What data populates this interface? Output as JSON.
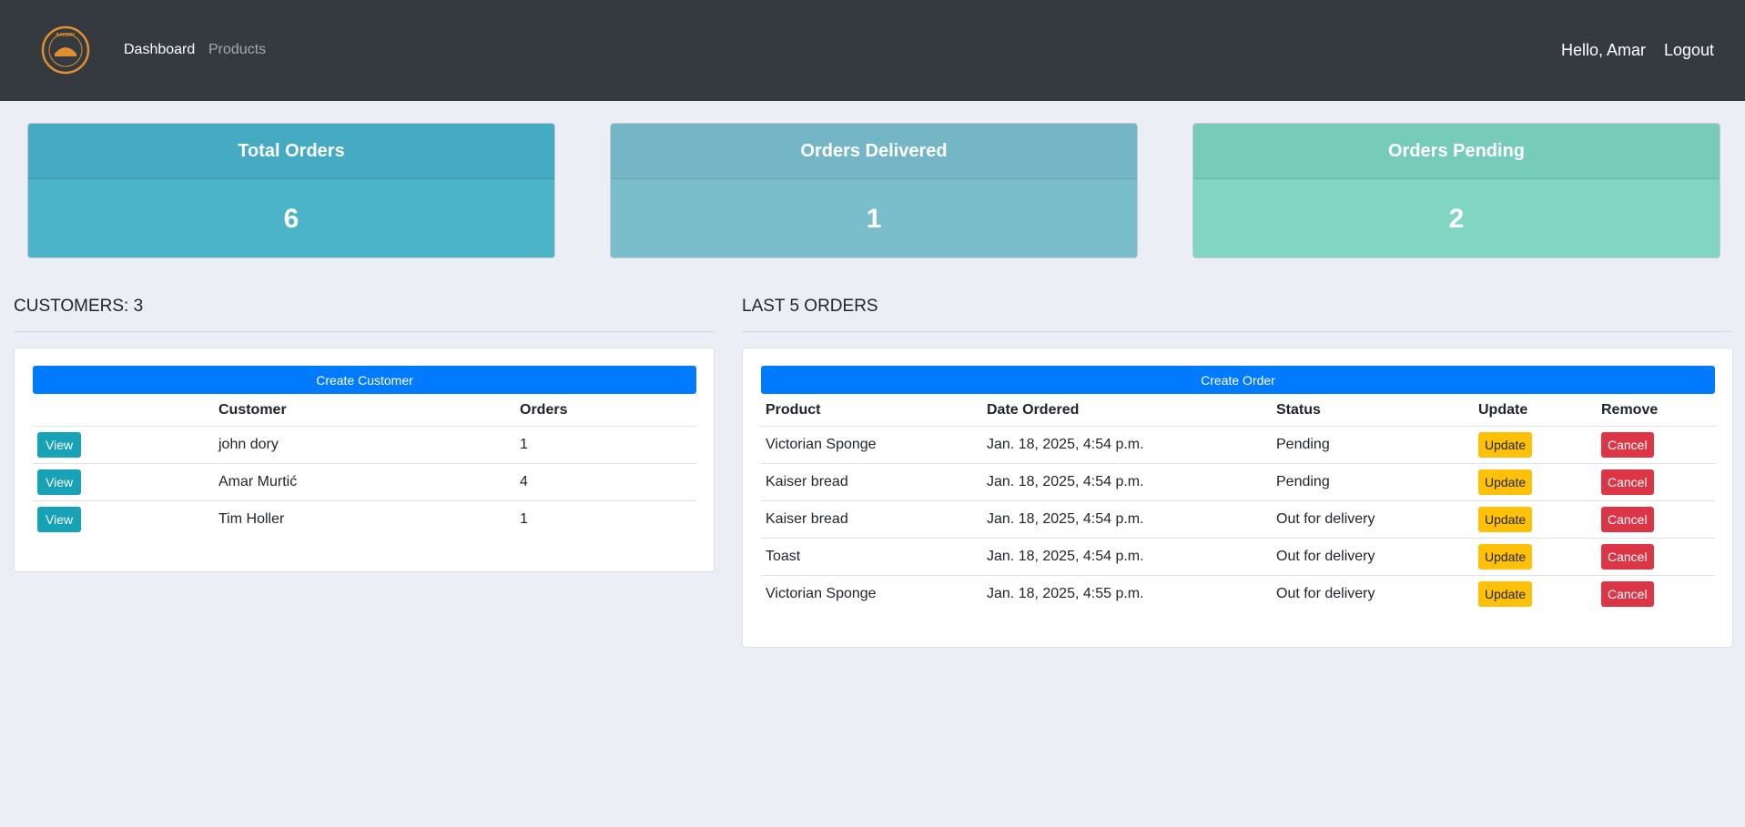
{
  "navbar": {
    "links": [
      {
        "label": "Dashboard"
      },
      {
        "label": "Products"
      }
    ],
    "greeting": "Hello, Amar",
    "logout": "Logout",
    "logo_text": "BAKERY"
  },
  "stats": [
    {
      "title": "Total Orders",
      "value": "6"
    },
    {
      "title": "Orders Delivered",
      "value": "1"
    },
    {
      "title": "Orders Pending",
      "value": "2"
    }
  ],
  "customers": {
    "heading": "CUSTOMERS: 3",
    "create_label": "Create Customer",
    "columns": [
      "",
      "Customer",
      "Orders"
    ],
    "view_label": "View",
    "rows": [
      {
        "name": "john dory",
        "orders": "1"
      },
      {
        "name": "Amar Murtić",
        "orders": "4"
      },
      {
        "name": "Tim Holler",
        "orders": "1"
      }
    ]
  },
  "orders": {
    "heading": "LAST 5 ORDERS",
    "create_label": "Create Order",
    "columns": [
      "Product",
      "Date Ordered",
      "Status",
      "Update",
      "Remove"
    ],
    "update_label": "Update",
    "remove_label": "Cancel",
    "rows": [
      {
        "product": "Victorian Sponge",
        "date": "Jan. 18, 2025, 4:54 p.m.",
        "status": "Pending"
      },
      {
        "product": "Kaiser bread",
        "date": "Jan. 18, 2025, 4:54 p.m.",
        "status": "Pending"
      },
      {
        "product": "Kaiser bread",
        "date": "Jan. 18, 2025, 4:54 p.m.",
        "status": "Out for delivery"
      },
      {
        "product": "Toast",
        "date": "Jan. 18, 2025, 4:54 p.m.",
        "status": "Out for delivery"
      },
      {
        "product": "Victorian Sponge",
        "date": "Jan. 18, 2025, 4:55 p.m.",
        "status": "Out for delivery"
      }
    ]
  },
  "colors": {
    "navbar": "#343a40",
    "primary": "#007bff",
    "info": "#17a2b8",
    "warning": "#ffc107",
    "danger": "#dc3545",
    "logo": "#e0902f"
  }
}
